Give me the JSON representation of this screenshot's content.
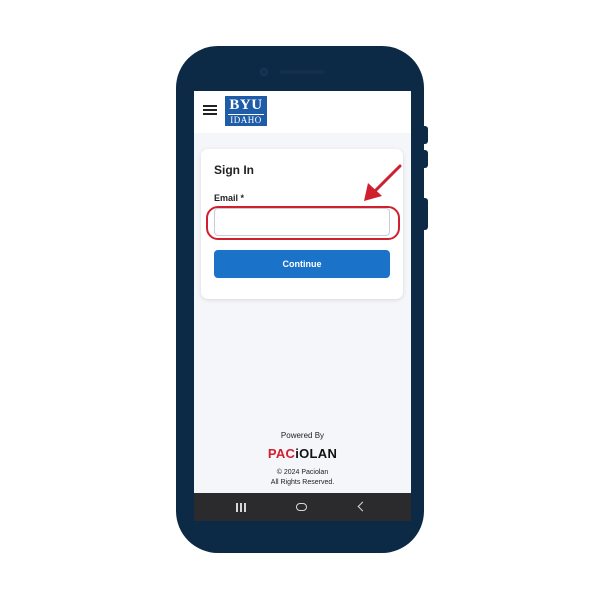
{
  "header": {
    "menu_icon": "hamburger-menu-icon",
    "logo_top": "BYU",
    "logo_bottom": "IDAHO",
    "brand_color": "#1f5ca8"
  },
  "signin": {
    "title": "Sign In",
    "email_label": "Email *",
    "email_value": "",
    "email_placeholder": "",
    "continue_label": "Continue",
    "button_color": "#1a73c8",
    "highlight_color": "#d0202f"
  },
  "footer": {
    "powered_by": "Powered By",
    "brand_red": "PAC",
    "brand_dark": "iOLAN",
    "copyright_line1": "© 2024 Paciolan",
    "copyright_line2": "All Rights Reserved."
  },
  "android_nav": {
    "recents_icon": "recents-icon",
    "home_icon": "home-icon",
    "back_icon": "back-icon"
  },
  "device": {
    "frame_color": "#0c2a46"
  }
}
